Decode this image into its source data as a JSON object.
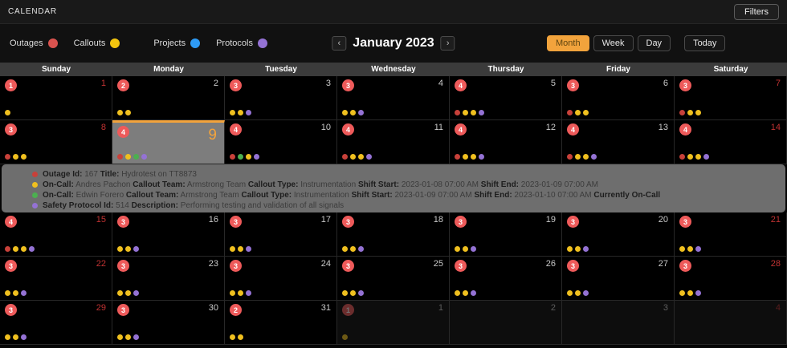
{
  "header": {
    "app_title": "CALENDAR",
    "filters_button": "Filters"
  },
  "toolbar": {
    "legend": [
      {
        "label": "Outages",
        "color": "#d9534f"
      },
      {
        "label": "Callouts",
        "color": "#f2c40f"
      },
      {
        "label": "Projects",
        "color": "#2e9bf5"
      },
      {
        "label": "Protocols",
        "color": "#9472d4"
      }
    ],
    "nav": {
      "prev": "‹",
      "title": "January 2023",
      "next": "›"
    },
    "view_buttons": [
      {
        "label": "Month",
        "active": true
      },
      {
        "label": "Week",
        "active": false
      },
      {
        "label": "Day",
        "active": false
      }
    ],
    "today_button": "Today"
  },
  "colors": {
    "red": "#c8413a",
    "yellow": "#f0c01f",
    "green": "#4caf50",
    "purple": "#9472d4",
    "blue": "#2e9bf5",
    "badge": "#ee5a5a",
    "accent_orange": "#f2a33c"
  },
  "calendar": {
    "day_headers": [
      "Sunday",
      "Monday",
      "Tuesday",
      "Wednesday",
      "Thursday",
      "Friday",
      "Saturday"
    ],
    "weeks": [
      [
        {
          "date": "1",
          "badge": "1",
          "dots": [
            "yellow"
          ],
          "weekend": true
        },
        {
          "date": "2",
          "badge": "2",
          "dots": [
            "yellow",
            "yellow"
          ]
        },
        {
          "date": "3",
          "badge": "3",
          "dots": [
            "yellow",
            "yellow",
            "purple"
          ]
        },
        {
          "date": "4",
          "badge": "3",
          "dots": [
            "yellow",
            "yellow",
            "purple"
          ]
        },
        {
          "date": "5",
          "badge": "4",
          "dots": [
            "red",
            "yellow",
            "yellow",
            "purple"
          ]
        },
        {
          "date": "6",
          "badge": "3",
          "dots": [
            "red",
            "yellow",
            "yellow"
          ]
        },
        {
          "date": "7",
          "badge": "3",
          "dots": [
            "red",
            "yellow",
            "yellow"
          ],
          "weekend": true
        }
      ],
      [
        {
          "date": "8",
          "badge": "3",
          "dots": [
            "red",
            "yellow",
            "yellow"
          ],
          "weekend": true
        },
        {
          "date": "9",
          "badge": "4",
          "dots": [
            "red",
            "yellow",
            "green",
            "purple"
          ],
          "selected": true
        },
        {
          "date": "10",
          "badge": "4",
          "dots": [
            "red",
            "green",
            "yellow",
            "purple"
          ]
        },
        {
          "date": "11",
          "badge": "4",
          "dots": [
            "red",
            "yellow",
            "yellow",
            "purple"
          ]
        },
        {
          "date": "12",
          "badge": "4",
          "dots": [
            "red",
            "yellow",
            "yellow",
            "purple"
          ]
        },
        {
          "date": "13",
          "badge": "4",
          "dots": [
            "red",
            "yellow",
            "yellow",
            "purple"
          ]
        },
        {
          "date": "14",
          "badge": "4",
          "dots": [
            "red",
            "yellow",
            "yellow",
            "purple"
          ],
          "weekend": true
        }
      ],
      [
        {
          "date": "15",
          "badge": "4",
          "dots": [
            "red",
            "yellow",
            "yellow",
            "purple"
          ],
          "weekend": true
        },
        {
          "date": "16",
          "badge": "3",
          "dots": [
            "yellow",
            "yellow",
            "purple"
          ]
        },
        {
          "date": "17",
          "badge": "3",
          "dots": [
            "yellow",
            "yellow",
            "purple"
          ]
        },
        {
          "date": "18",
          "badge": "3",
          "dots": [
            "yellow",
            "yellow",
            "purple"
          ]
        },
        {
          "date": "19",
          "badge": "3",
          "dots": [
            "yellow",
            "yellow",
            "purple"
          ]
        },
        {
          "date": "20",
          "badge": "3",
          "dots": [
            "yellow",
            "yellow",
            "purple"
          ]
        },
        {
          "date": "21",
          "badge": "3",
          "dots": [
            "yellow",
            "yellow",
            "purple"
          ],
          "weekend": true
        }
      ],
      [
        {
          "date": "22",
          "badge": "3",
          "dots": [
            "yellow",
            "yellow",
            "purple"
          ],
          "weekend": true
        },
        {
          "date": "23",
          "badge": "3",
          "dots": [
            "yellow",
            "yellow",
            "purple"
          ]
        },
        {
          "date": "24",
          "badge": "3",
          "dots": [
            "yellow",
            "yellow",
            "purple"
          ]
        },
        {
          "date": "25",
          "badge": "3",
          "dots": [
            "yellow",
            "yellow",
            "purple"
          ]
        },
        {
          "date": "26",
          "badge": "3",
          "dots": [
            "yellow",
            "yellow",
            "purple"
          ]
        },
        {
          "date": "27",
          "badge": "3",
          "dots": [
            "yellow",
            "yellow",
            "purple"
          ]
        },
        {
          "date": "28",
          "badge": "3",
          "dots": [
            "yellow",
            "yellow",
            "purple"
          ],
          "weekend": true
        }
      ],
      [
        {
          "date": "29",
          "badge": "3",
          "dots": [
            "yellow",
            "yellow",
            "purple"
          ],
          "weekend": true
        },
        {
          "date": "30",
          "badge": "3",
          "dots": [
            "yellow",
            "yellow",
            "purple"
          ]
        },
        {
          "date": "31",
          "badge": "2",
          "dots": [
            "yellow",
            "yellow"
          ]
        },
        {
          "date": "1",
          "badge": "1",
          "dots": [
            "yellow"
          ],
          "other_month": true
        },
        {
          "date": "2",
          "other_month": true
        },
        {
          "date": "3",
          "other_month": true
        },
        {
          "date": "4",
          "other_month": true,
          "weekend": true
        }
      ]
    ]
  },
  "tooltip": {
    "after_week": 1,
    "lines": [
      {
        "dot": "red",
        "segments": [
          {
            "t": "Outage Id:",
            "b": true
          },
          {
            "t": " 167 "
          },
          {
            "t": "Title:",
            "b": true
          },
          {
            "t": " Hydrotest on TT8873"
          }
        ]
      },
      {
        "dot": "yellow",
        "segments": [
          {
            "t": "On-Call:",
            "b": true
          },
          {
            "t": " Andres Pachon "
          },
          {
            "t": "Callout Team:",
            "b": true
          },
          {
            "t": " Armstrong Team "
          },
          {
            "t": "Callout Type:",
            "b": true
          },
          {
            "t": " Instrumentation "
          },
          {
            "t": "Shift Start:",
            "b": true
          },
          {
            "t": " 2023-01-08 07:00 AM "
          },
          {
            "t": "Shift End:",
            "b": true
          },
          {
            "t": " 2023-01-09 07:00 AM"
          }
        ]
      },
      {
        "dot": "green",
        "segments": [
          {
            "t": "On-Call:",
            "b": true
          },
          {
            "t": " Edwin Forero "
          },
          {
            "t": "Callout Team:",
            "b": true
          },
          {
            "t": " Armstrong Team "
          },
          {
            "t": "Callout Type:",
            "b": true
          },
          {
            "t": " Instrumentation "
          },
          {
            "t": "Shift Start:",
            "b": true
          },
          {
            "t": " 2023-01-09 07:00 AM "
          },
          {
            "t": "Shift End:",
            "b": true
          },
          {
            "t": " 2023-01-10 07:00 AM "
          },
          {
            "t": "Currently On-Call",
            "b": true
          }
        ]
      },
      {
        "dot": "purple",
        "segments": [
          {
            "t": "Safety Protocol Id:",
            "b": true
          },
          {
            "t": " 514 "
          },
          {
            "t": "Description:",
            "b": true
          },
          {
            "t": " Performing testing and validation of all signals"
          }
        ]
      }
    ]
  }
}
